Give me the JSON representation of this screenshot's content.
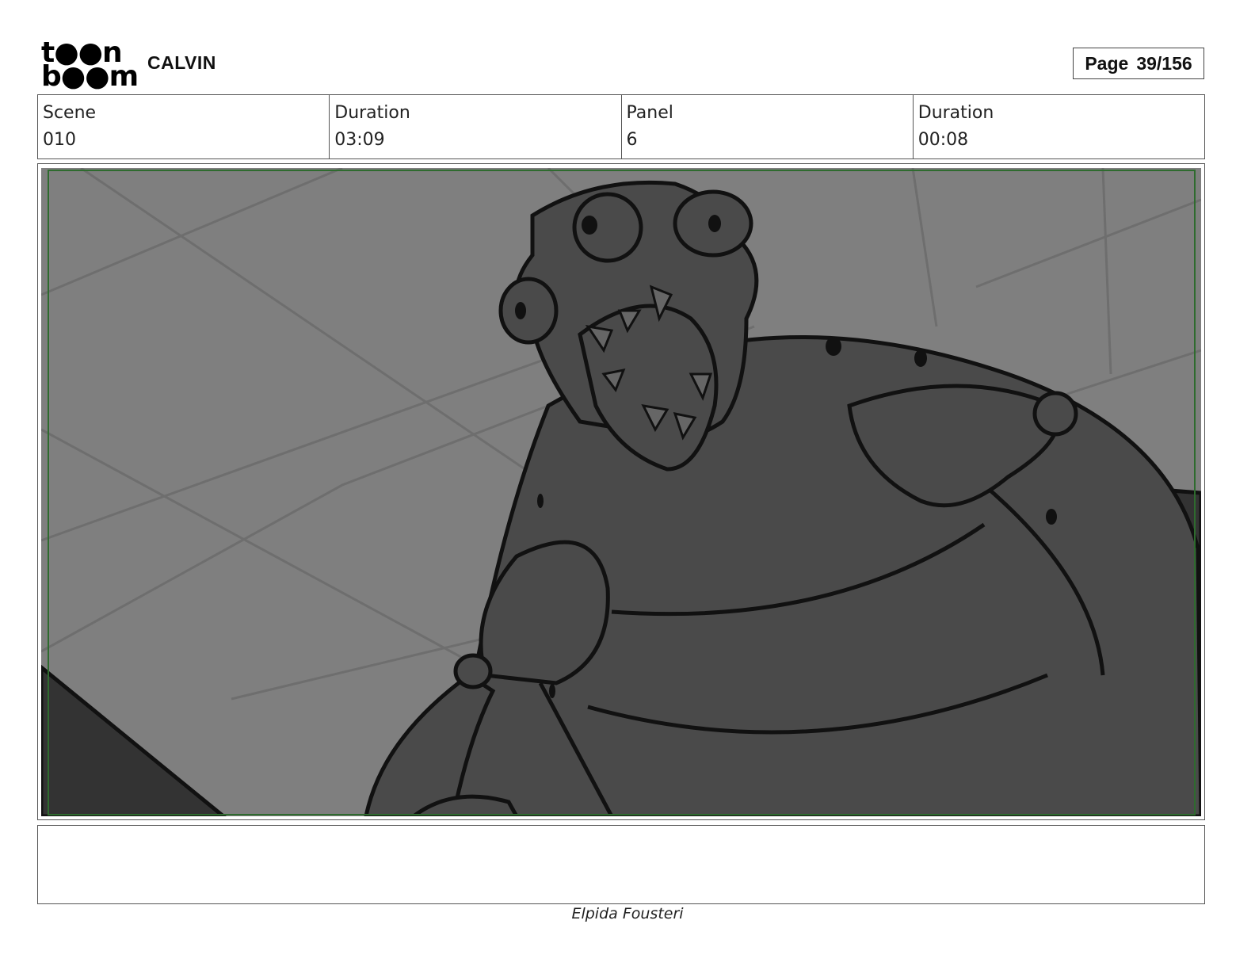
{
  "logo": {
    "line1": "t●●n",
    "line2": "b●●m"
  },
  "project": {
    "title": "CALVIN"
  },
  "page": {
    "label": "Page",
    "number": "39/156"
  },
  "info": [
    {
      "label": "Scene",
      "value": "010"
    },
    {
      "label": "Duration",
      "value": "03:09"
    },
    {
      "label": "Panel",
      "value": "6"
    },
    {
      "label": "Duration",
      "value": "00:08"
    }
  ],
  "notes": {
    "text": ""
  },
  "author": "Elpida Fousteri",
  "colors": {
    "background": "#7f7f7f",
    "body": "#4a4a4a",
    "shadow": "#333333",
    "safe_frame": "#2e6b2e"
  }
}
